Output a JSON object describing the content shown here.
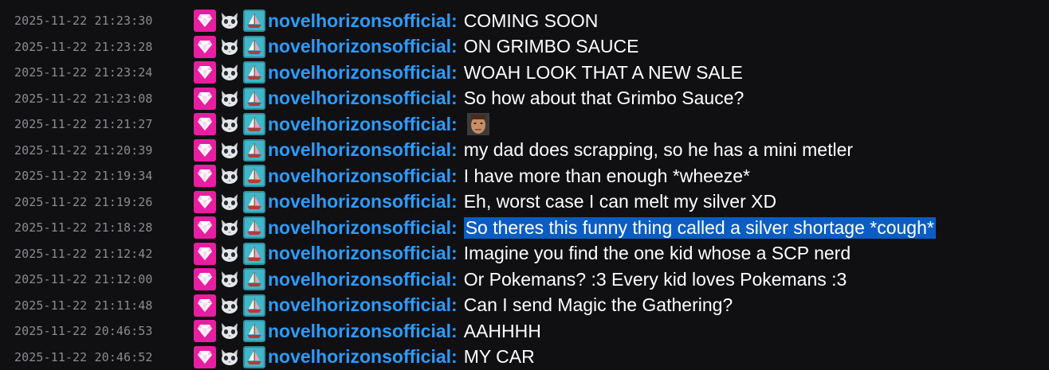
{
  "chat": {
    "colors": {
      "background": "#101012",
      "timestamp": "#8b8b91",
      "username": "#2e9bff",
      "message": "#ffffff",
      "selection": "#0a5dc2",
      "gem_badge": "#e81ea2",
      "boat_badge": "#40b6c8"
    },
    "badge_icons": [
      "gem-icon",
      "cat-icon",
      "sailboat-icon"
    ],
    "messages": [
      {
        "timestamp": "2025-11-22 21:23:30",
        "user": "novelhorizonsofficial:",
        "text": "COMING SOON"
      },
      {
        "timestamp": "2025-11-22 21:23:28",
        "user": "novelhorizonsofficial:",
        "text": "ON GRIMBO SAUCE"
      },
      {
        "timestamp": "2025-11-22 21:23:24",
        "user": "novelhorizonsofficial:",
        "text": "WOAH LOOK THAT A NEW SALE"
      },
      {
        "timestamp": "2025-11-22 21:23:08",
        "user": "novelhorizonsofficial:",
        "text": "So how about that Grimbo Sauce?"
      },
      {
        "timestamp": "2025-11-22 21:21:27",
        "user": "novelhorizonsofficial:",
        "text": "",
        "emote": "face-emote-icon"
      },
      {
        "timestamp": "2025-11-22 21:20:39",
        "user": "novelhorizonsofficial:",
        "text": "my dad does scrapping, so he has a mini metler"
      },
      {
        "timestamp": "2025-11-22 21:19:34",
        "user": "novelhorizonsofficial:",
        "text": "I have more than enough *wheeze*"
      },
      {
        "timestamp": "2025-11-22 21:19:26",
        "user": "novelhorizonsofficial:",
        "text": "Eh, worst case I can melt my silver XD"
      },
      {
        "timestamp": "2025-11-22 21:18:28",
        "user": "novelhorizonsofficial:",
        "text": "So theres this funny thing called a silver shortage *cough*",
        "selected": true
      },
      {
        "timestamp": "2025-11-22 21:12:42",
        "user": "novelhorizonsofficial:",
        "text": "Imagine you find the one kid whose a SCP nerd"
      },
      {
        "timestamp": "2025-11-22 21:12:00",
        "user": "novelhorizonsofficial:",
        "text": "Or Pokemans? :3 Every kid loves Pokemans :3"
      },
      {
        "timestamp": "2025-11-22 21:11:48",
        "user": "novelhorizonsofficial:",
        "text": "Can I send Magic the Gathering?"
      },
      {
        "timestamp": "2025-11-22 20:46:53",
        "user": "novelhorizonsofficial:",
        "text": "AAHHHH"
      },
      {
        "timestamp": "2025-11-22 20:46:52",
        "user": "novelhorizonsofficial:",
        "text": "MY CAR"
      }
    ]
  }
}
